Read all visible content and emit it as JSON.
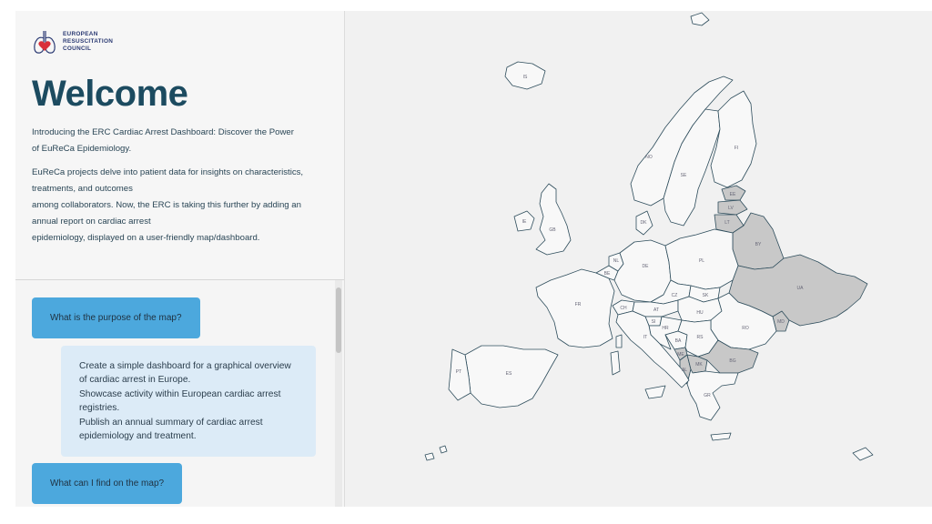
{
  "logo": {
    "lines": [
      "EUROPEAN",
      "RESUSCITATION",
      "COUNCIL"
    ]
  },
  "intro": {
    "title": "Welcome",
    "paragraph1": [
      "Introducing the ERC Cardiac Arrest Dashboard: Discover the Power",
      "of EuReCa Epidemiology."
    ],
    "paragraph2": [
      "EuReCa projects delve into patient data for insights on characteristics,",
      "treatments, and outcomes",
      "among collaborators. Now, the ERC is taking this further by adding an",
      "annual report on cardiac arrest",
      "epidemiology, displayed on a user-friendly map/dashboard."
    ]
  },
  "faq": {
    "q1": "What is the purpose of the map?",
    "a1": [
      "Create a simple dashboard for a graphical overview",
      "of cardiac arrest in Europe.",
      "Showcase activity within European cardiac arrest",
      "registries.",
      "Publish an annual summary of cardiac arrest",
      "epidemiology and treatment."
    ],
    "q2": "What can I find on the map?"
  },
  "map": {
    "colors": {
      "land": "#f8f8f8",
      "highlight": "#c8c8c8",
      "border": "#2e4d5c",
      "background": "#f1f1f1"
    },
    "labels": {
      "IS": "IS",
      "NO": "NO",
      "SE": "SE",
      "FI": "FI",
      "IE": "IE",
      "GB": "GB",
      "FR": "FR",
      "ES": "ES",
      "PT": "PT",
      "DE": "DE",
      "PL": "PL",
      "CZ": "CZ",
      "AT": "AT",
      "HU": "HU",
      "IT": "IT",
      "RO": "RO",
      "BG": "BG",
      "UA": "UA",
      "BY": "BY",
      "GR": "GR",
      "LT": "LT",
      "LV": "LV",
      "EE": "EE",
      "DK": "DK",
      "NL": "NL",
      "BE": "BE",
      "CH": "CH",
      "SK": "SK",
      "MD": "MD",
      "RS": "RS",
      "MK": "MK",
      "AL": "AL",
      "BA": "BA",
      "HR": "HR",
      "SI": "SI",
      "ME": "ME"
    }
  }
}
